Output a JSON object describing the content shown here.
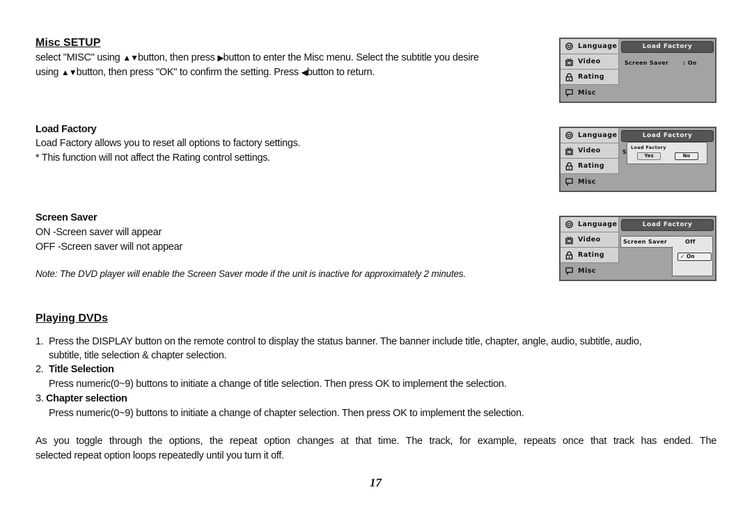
{
  "misc_setup": {
    "heading": "Misc SETUP",
    "line1_a": "select \"MISC\" using ",
    "line1_tri": "▲▼",
    "line1_b": "button, then press ",
    "line1_tri2": "▶",
    "line1_c": "button to enter the Misc menu. Select the subtitle you desire",
    "line2_a": "using ",
    "line2_tri": "▲▼",
    "line2_b": "button, then press \"OK\" to confirm the setting. Press ",
    "line2_tri2": "◀",
    "line2_c": "button to return."
  },
  "load_factory": {
    "heading": "Load Factory",
    "line1": "Load Factory allows you to reset all options to factory settings.",
    "line2": "* This function will not affect the Rating control settings."
  },
  "screen_saver": {
    "heading": "Screen Saver",
    "line1": "ON -Screen saver will appear",
    "line2": "OFF -Screen saver will not appear",
    "note": "Note: The DVD player will enable the Screen Saver mode if the unit is inactive for approximately 2 minutes."
  },
  "playing_dvds": {
    "heading": "Playing DVDs",
    "item1_num": "1.",
    "item1_line1": "Press the DISPLAY button on the remote control to display the status banner. The banner include title, chapter, angle, audio, subtitle, audio,",
    "item1_line2": "subtitle, title selection & chapter selection.",
    "item2_num": "2.",
    "item2_title": "Title Selection",
    "item2_text": "Press numeric(0~9) buttons to initiate a change of title selection. Then press OK to implement the selection.",
    "item3_num": "3.",
    "item3_title": "Chapter selection",
    "item3_text": "Press numeric(0~9) buttons to initiate a change of chapter selection. Then press OK to implement the selection.",
    "para_line1": "As you toggle through the options, the repeat option changes at that time. The track, for example, repeats once that track has ended. The",
    "para_line2": "selected repeat option loops repeatedly until you turn it off."
  },
  "page_number": "17",
  "osd": {
    "menu_items": [
      {
        "label": "Language",
        "icon": "face-icon"
      },
      {
        "label": "Video",
        "icon": "tv-icon"
      },
      {
        "label": "Rating",
        "icon": "lock-icon"
      },
      {
        "label": "Misc",
        "icon": "speech-bubble-icon"
      }
    ],
    "title": "Load Factory",
    "panel1": {
      "setting_label": "Screen Saver",
      "setting_value": ": On"
    },
    "panel2": {
      "dialog_title": "Load Factory",
      "yes_label": "Yes",
      "no_label": "No",
      "hidden_char": "S"
    },
    "panel3": {
      "setting_label": "Screen Saver",
      "option_off": "Off",
      "option_on": "✓ On"
    }
  }
}
